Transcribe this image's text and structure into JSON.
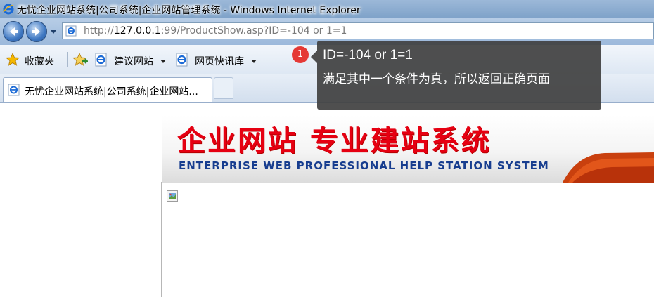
{
  "window": {
    "title": "无忧企业网站系统|公司系统|企业网站管理系统 - Windows Internet Explorer"
  },
  "address_bar": {
    "url_prefix": "http://",
    "url_host": "127.0.0.1",
    "url_rest": ":99/ProductShow.asp?ID=-104 or 1=1"
  },
  "favorites_bar": {
    "favorites_label": "收藏夹",
    "suggested_sites_label": "建议网站",
    "web_slice_label": "网页快讯库"
  },
  "tab": {
    "label": "无忧企业网站系统|公司系统|企业网站..."
  },
  "page": {
    "banner_title": "企业网站 专业建站系统",
    "banner_subtitle": "ENTERPRISE WEB PROFESSIONAL HELP STATION SYSTEM"
  },
  "annotation": {
    "badge": "1",
    "line1": "ID=-104 or 1=1",
    "line2": "满足其中一个条件为真，所以返回正确页面"
  },
  "colors": {
    "banner_red": "#e60012",
    "banner_blue": "#173d8f",
    "tooltip_bg": "#404040",
    "badge_red": "#e53935"
  }
}
